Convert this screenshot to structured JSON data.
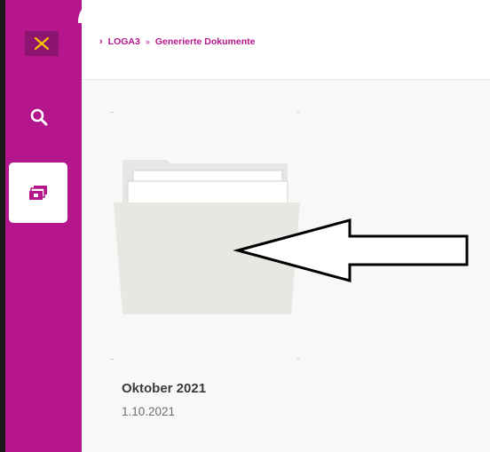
{
  "sidebar": {
    "accent_color": "#b6168c",
    "items": [
      {
        "icon": "close-x-icon"
      },
      {
        "icon": "search-icon"
      },
      {
        "icon": "documents-icon",
        "active": true
      }
    ]
  },
  "header": {
    "breadcrumb": {
      "root": "LOGA3",
      "separator": "»",
      "current": "Generierte Dokumente"
    }
  },
  "documents": [
    {
      "title": "Oktober 2021",
      "date": "1.10.2021",
      "icon": "folder-icon"
    }
  ],
  "annotation": {
    "icon": "arrow-left-icon"
  }
}
